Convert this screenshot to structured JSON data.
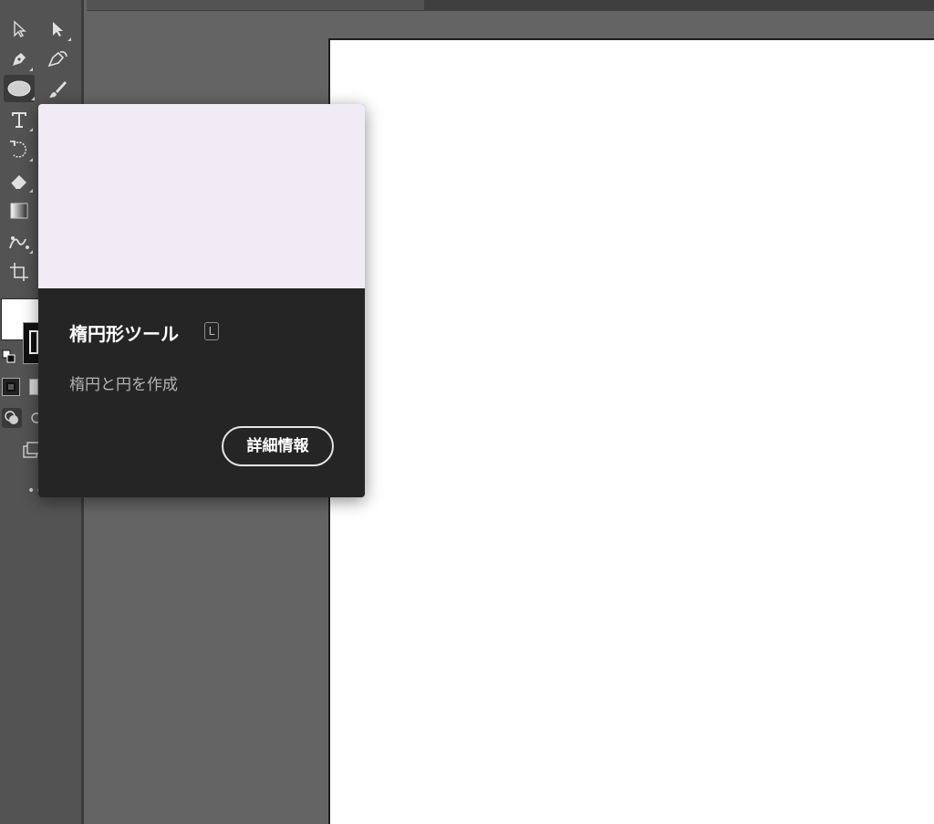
{
  "tooltip": {
    "title": "楕円形ツール",
    "shortcut": "L",
    "description": "楕円と円を作成",
    "details_label": "詳細情報",
    "preview_color": "#f1ebf6"
  },
  "toolbar": {
    "tools": [
      "selection-icon",
      "direct-selection-icon",
      "pen-icon",
      "curvature-icon",
      "ellipse-icon",
      "paintbrush-icon",
      "type-icon",
      "rotate-icon",
      "eraser-icon",
      "gradient-icon",
      "puppet-warp-icon",
      "artboard-icon"
    ],
    "fill_color": "#ffffff",
    "stroke_color": "#111111"
  },
  "canvas": {
    "background": "#646464",
    "artboard_color": "#ffffff"
  }
}
